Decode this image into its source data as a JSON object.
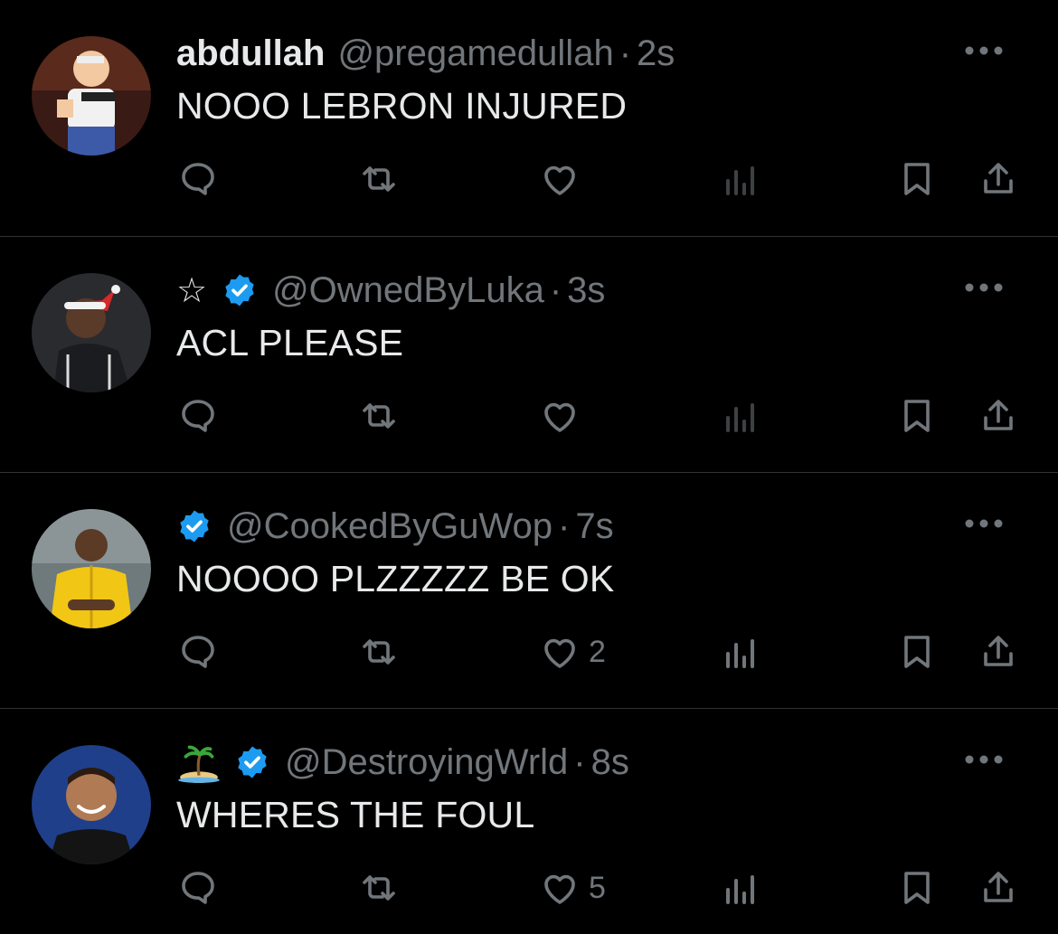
{
  "colors": {
    "background": "#000000",
    "text_primary": "#e7e9ea",
    "text_secondary": "#71767b",
    "divider": "#2f3336",
    "verified_blue": "#1d9bf0"
  },
  "tweets": [
    {
      "name": "abdullah",
      "name_prefix_icon": "",
      "verified": false,
      "handle": "@pregamedullah",
      "separator": "·",
      "time": "2s",
      "text": "NOOO LEBRON INJURED",
      "likes": "",
      "avatar": "cartoon-character-avatar"
    },
    {
      "name": "",
      "name_prefix_icon": "star-icon",
      "name_prefix_text": "☆",
      "verified": true,
      "handle": "@OwnedByLuka",
      "separator": "·",
      "time": "3s",
      "text": "ACL PLEASE",
      "likes": "",
      "avatar": "player-santa-hat-avatar"
    },
    {
      "name": "",
      "name_prefix_icon": "",
      "verified": true,
      "handle": "@CookedByGuWop",
      "separator": "·",
      "time": "7s",
      "text": "NOOOO PLZZZZZ BE OK",
      "likes": "2",
      "avatar": "player-yellow-jacket-avatar"
    },
    {
      "name": "",
      "name_prefix_icon": "island-emoji-icon",
      "verified": true,
      "handle": "@DestroyingWrld",
      "separator": "·",
      "time": "8s",
      "text": "WHERES THE FOUL",
      "likes": "5",
      "avatar": "smiling-player-avatar"
    }
  ]
}
